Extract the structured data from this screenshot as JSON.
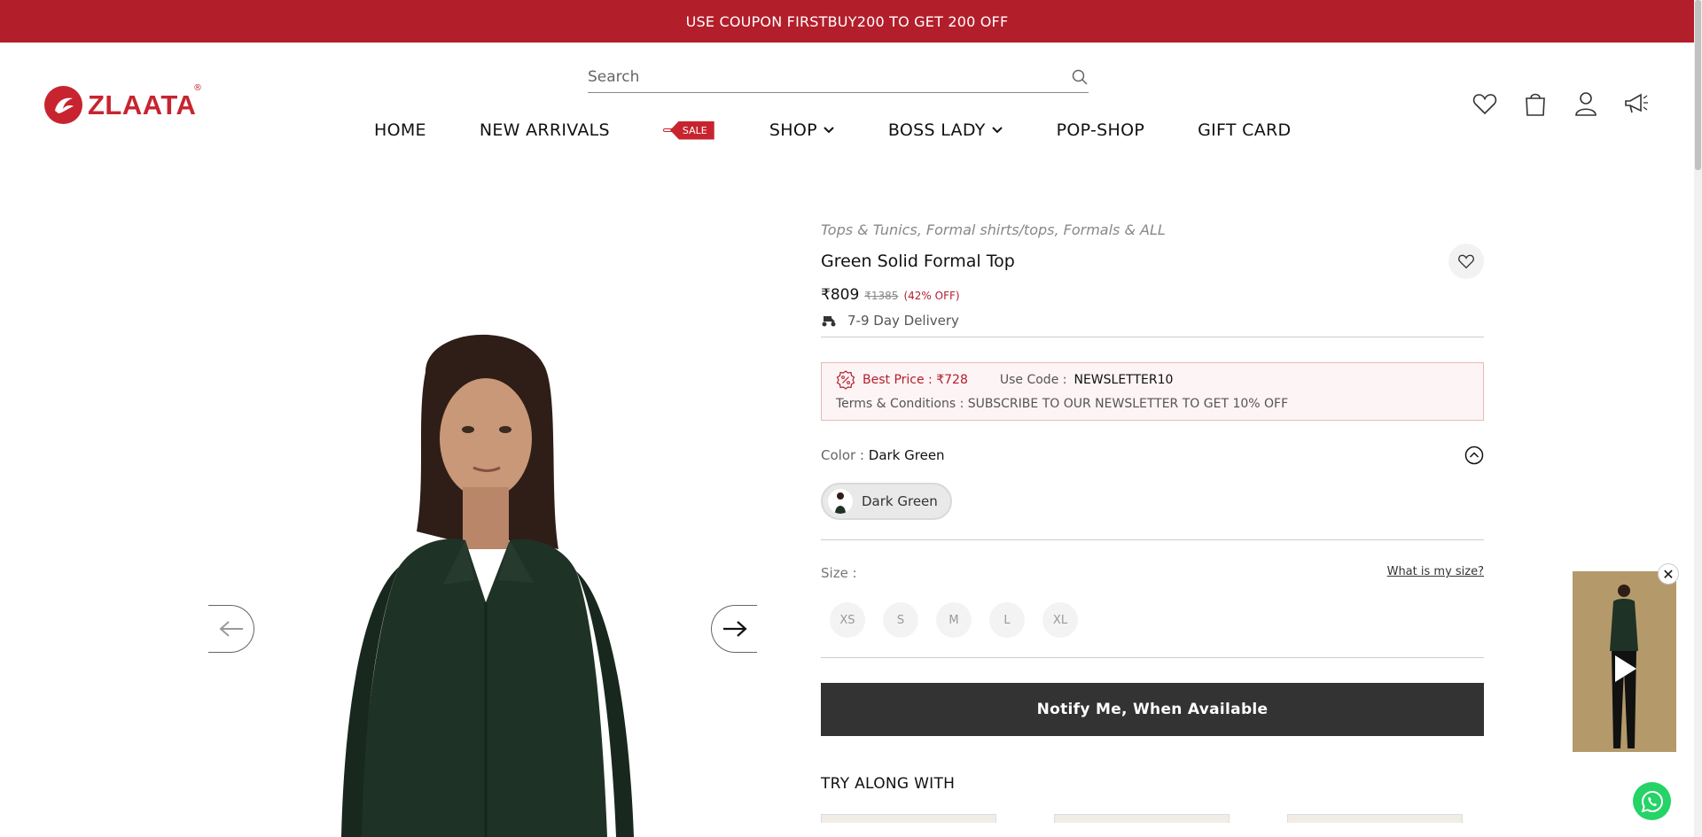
{
  "promo": {
    "text": "USE COUPON FIRSTBUY200 TO GET 200 OFF"
  },
  "logo": {
    "text": "ZLAATA",
    "registered": "®"
  },
  "search": {
    "placeholder": "Search"
  },
  "nav": {
    "home": "HOME",
    "new_arrivals": "NEW ARRIVALS",
    "sale": "SALE",
    "shop": "SHOP",
    "boss_lady": "BOSS LADY",
    "pop_shop": "POP-SHOP",
    "gift_card": "GIFT CARD"
  },
  "product": {
    "breadcrumbs": "Tops & Tunics, Formal shirts/tops, Formals & ALL",
    "title": "Green Solid Formal Top",
    "price": "₹809",
    "mrp": "₹1385",
    "discount": "(42% OFF)",
    "delivery": "7-9 Day Delivery"
  },
  "offer": {
    "best_price": "Best Price : ₹728",
    "use_code_label": "Use Code :",
    "code": "NEWSLETTER10",
    "terms_label": "Terms & Conditions :",
    "terms": "SUBSCRIBE TO OUR NEWSLETTER TO GET 10% OFF"
  },
  "color": {
    "label": "Color :",
    "value": "Dark Green",
    "swatch": "Dark Green"
  },
  "size": {
    "label": "Size :",
    "help_link": "What is my size?",
    "options": [
      "XS",
      "S",
      "M",
      "L",
      "XL"
    ]
  },
  "notify_button": "Notify Me, When Available",
  "try_along": {
    "title": "TRY ALONG WITH"
  },
  "colors": {
    "brand": "#c7242f",
    "promo_bg": "#b31e2b",
    "button_bg": "#333333",
    "product_green": "#1f3226"
  }
}
